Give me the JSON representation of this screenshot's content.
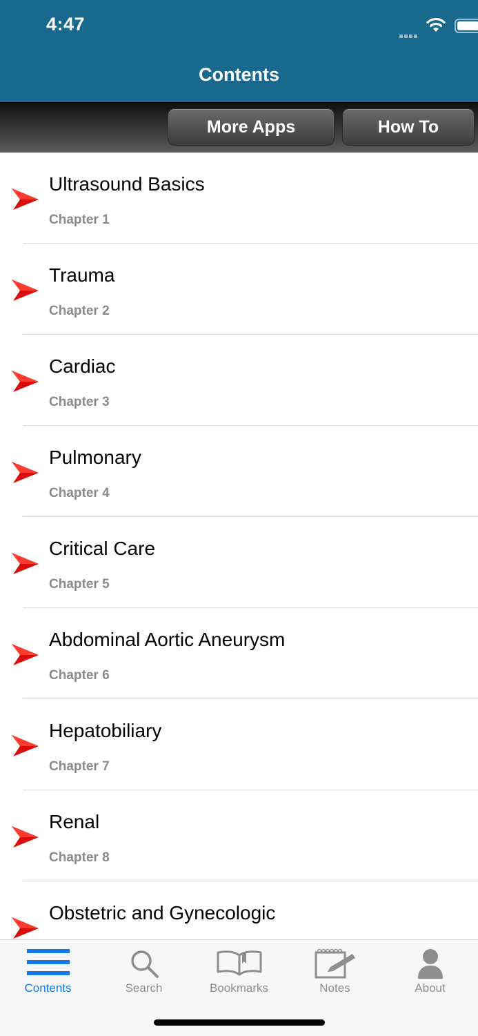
{
  "status_bar": {
    "time": "4:47"
  },
  "nav": {
    "title": "Contents"
  },
  "toolbar": {
    "more_apps": "More Apps",
    "how_to": "How To"
  },
  "chapters": [
    {
      "title": "Ultrasound Basics",
      "subtitle": "Chapter 1"
    },
    {
      "title": "Trauma",
      "subtitle": "Chapter 2"
    },
    {
      "title": "Cardiac",
      "subtitle": "Chapter 3"
    },
    {
      "title": "Pulmonary",
      "subtitle": "Chapter 4"
    },
    {
      "title": "Critical Care",
      "subtitle": "Chapter 5"
    },
    {
      "title": "Abdominal Aortic Aneurysm",
      "subtitle": "Chapter 6"
    },
    {
      "title": "Hepatobiliary",
      "subtitle": "Chapter 7"
    },
    {
      "title": "Renal",
      "subtitle": "Chapter 8"
    },
    {
      "title": "Obstetric and Gynecologic",
      "subtitle": ""
    }
  ],
  "tabbar": {
    "tabs": [
      {
        "label": "Contents",
        "icon": "list-icon",
        "active": true
      },
      {
        "label": "Search",
        "icon": "search-icon",
        "active": false
      },
      {
        "label": "Bookmarks",
        "icon": "book-icon",
        "active": false
      },
      {
        "label": "Notes",
        "icon": "notepad-icon",
        "active": false
      },
      {
        "label": "About",
        "icon": "person-icon",
        "active": false
      }
    ]
  },
  "colors": {
    "header": "#19698f",
    "accent": "#1478e8",
    "arrow": "#d90b0b",
    "tab_inactive": "#8e8e8e"
  }
}
